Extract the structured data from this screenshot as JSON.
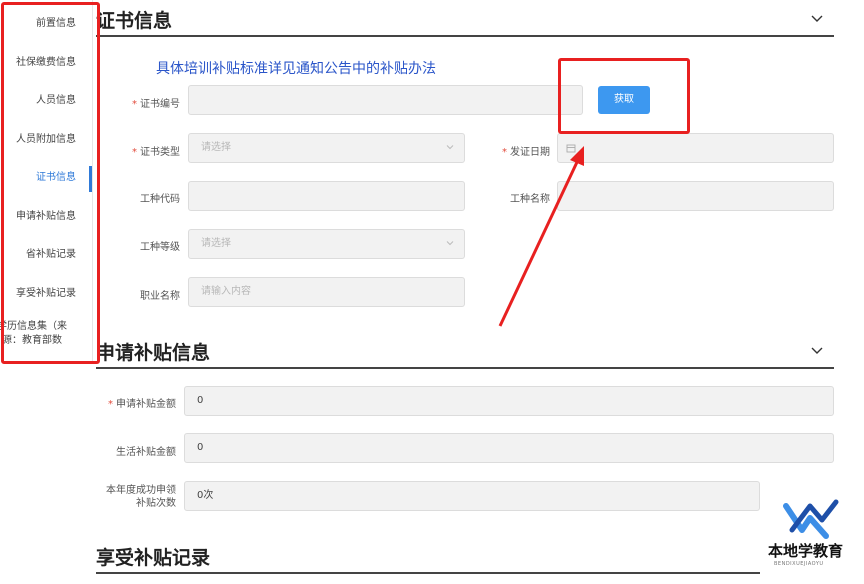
{
  "sidebar": {
    "items": [
      {
        "label": "前置信息"
      },
      {
        "label": "社保缴费信息"
      },
      {
        "label": "人员信息"
      },
      {
        "label": "人员附加信息"
      },
      {
        "label": "证书信息",
        "active": true
      },
      {
        "label": "申请补贴信息"
      },
      {
        "label": "省补贴记录"
      },
      {
        "label": "享受补贴记录"
      },
      {
        "label": "学历信息集（来源：教育部数"
      }
    ]
  },
  "cert_section": {
    "title": "证书信息",
    "notice": "具体培训补贴标准详见通知公告中的补贴办法",
    "fields": {
      "cert_no": {
        "label": "证书编号",
        "required": "*",
        "value": ""
      },
      "cert_type": {
        "label": "证书类型",
        "required": "*",
        "placeholder": "请选择"
      },
      "issue_date": {
        "label": "发证日期",
        "required": "*",
        "value": ""
      },
      "job_code": {
        "label": "工种代码",
        "value": ""
      },
      "job_name": {
        "label": "工种名称",
        "value": ""
      },
      "job_level": {
        "label": "工种等级",
        "placeholder": "请选择"
      },
      "occupation": {
        "label": "职业名称",
        "placeholder": "请输入内容"
      }
    },
    "get_button": "获取"
  },
  "apply_section": {
    "title": "申请补贴信息",
    "fields": {
      "amount": {
        "label": "申请补贴金额",
        "required": "*",
        "value": "0"
      },
      "living": {
        "label": "生活补贴金额",
        "value": "0"
      },
      "count": {
        "label_line1": "本年度成功申领",
        "label_line2": "补贴次数",
        "value": "0次"
      }
    }
  },
  "enjoy_section": {
    "title": "享受补贴记录"
  },
  "logo": {
    "name": "本地学教育",
    "sub": "BENDIXUEJIAOYU"
  },
  "colors": {
    "accent": "#2f7ad8",
    "button": "#3d98f0",
    "annotation": "#e82020",
    "notice": "#2a55c9"
  }
}
